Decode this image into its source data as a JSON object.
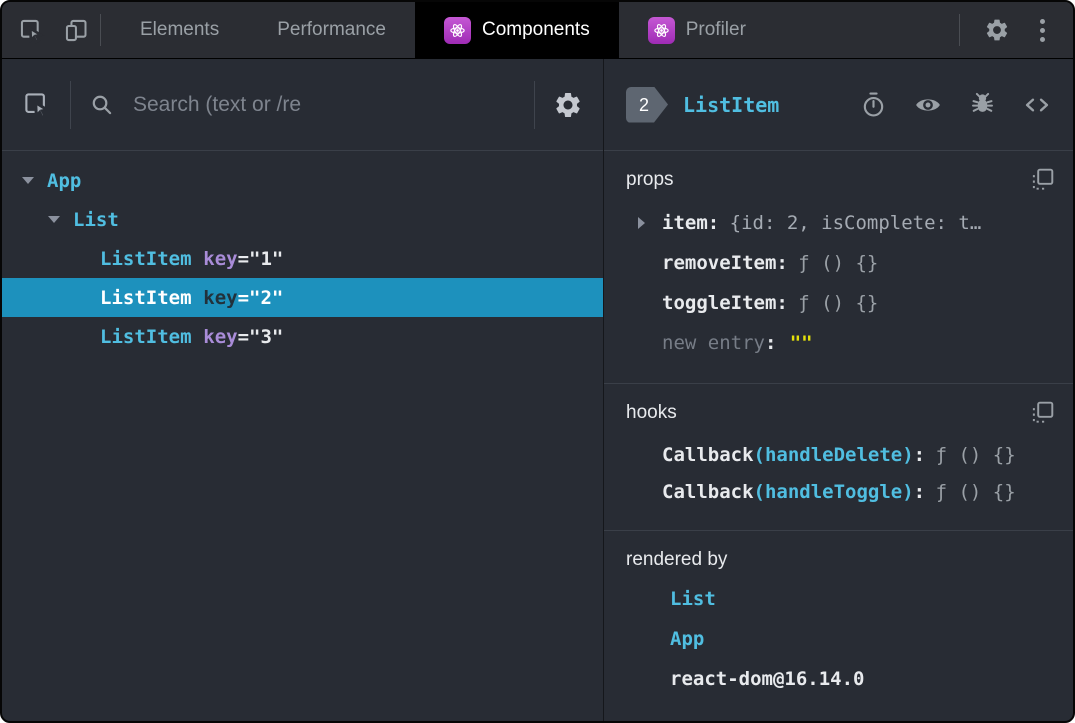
{
  "toolbar": {
    "tabs": [
      {
        "label": "Elements"
      },
      {
        "label": "Performance"
      },
      {
        "label": "Components"
      },
      {
        "label": "Profiler"
      }
    ]
  },
  "left_panel": {
    "search_placeholder": "Search (text or /re"
  },
  "tree": {
    "rows": [
      {
        "name": "App"
      },
      {
        "name": "List"
      },
      {
        "name": "ListItem",
        "attr": "key",
        "value": "=\"1\""
      },
      {
        "name": "ListItem",
        "attr": "key",
        "value": "=\"2\""
      },
      {
        "name": "ListItem",
        "attr": "key",
        "value": "=\"3\""
      }
    ]
  },
  "inspector": {
    "badge_count": "2",
    "component_name": "ListItem",
    "props": {
      "heading": "props",
      "rows": [
        {
          "key": "item",
          "colon": ":",
          "value": "{id: 2, isComplete: t…"
        },
        {
          "key": "removeItem",
          "colon": ":",
          "value": "ƒ () {}"
        },
        {
          "key": "toggleItem",
          "colon": ":",
          "value": "ƒ () {}"
        },
        {
          "key": "new entry",
          "colon": ":",
          "value": "\"\""
        }
      ]
    },
    "hooks": {
      "heading": "hooks",
      "rows": [
        {
          "hook": "Callback",
          "name": "(handleDelete)",
          "colon": ":",
          "value": "ƒ () {}"
        },
        {
          "hook": "Callback",
          "name": "(handleToggle)",
          "colon": ":",
          "value": "ƒ () {}"
        }
      ]
    },
    "rendered_by": {
      "heading": "rendered by",
      "owners": [
        "List",
        "App"
      ],
      "renderer": "react-dom@16.14.0"
    }
  },
  "colors": {
    "panel_background": "#282c34",
    "active_tab_background": "#000000",
    "selection": "#1d91bd",
    "component_name": "#50bee1",
    "attribute_name": "#a98cd8",
    "string_yellow": "#e5e10a",
    "value_gray": "#9aa0a6",
    "react_brand_purple": "#b13cc6"
  },
  "icons": {
    "inspect-cursor-icon": "square with cursor arrow",
    "device-toolbar-icon": "phone over tablet",
    "react-logo-icon": "atom in purple rounded square",
    "gear-icon": "settings gear",
    "kebab-menu-icon": "vertical three dots",
    "search-icon": "magnifier",
    "stopwatch-icon": "suspense timer",
    "eye-icon": "inspect DOM element",
    "bug-icon": "log component to console",
    "code-brackets-icon": "view source",
    "copy-icon": "copy to clipboard",
    "expander-icon": "triangle"
  }
}
